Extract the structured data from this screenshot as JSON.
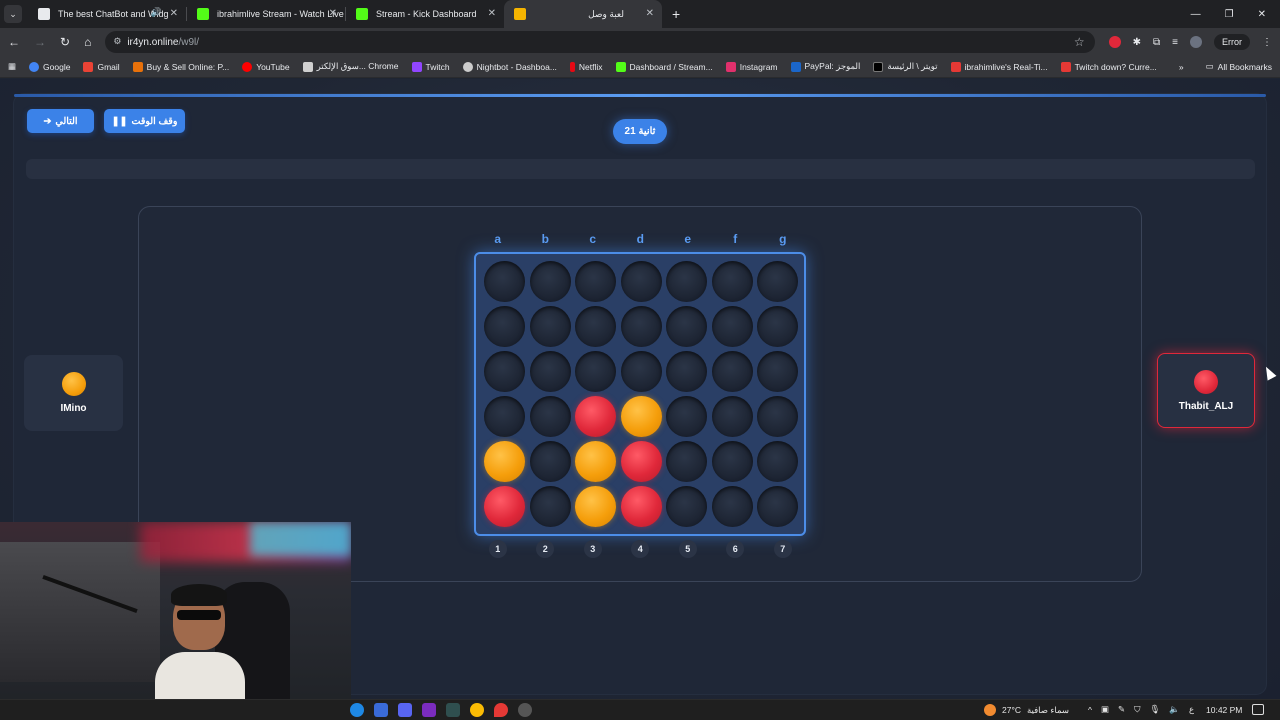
{
  "browser": {
    "tabs": [
      {
        "label": "The best ChatBot and Widg",
        "favicon_color": "#e8eaed"
      },
      {
        "label": "ibrahimlive Stream - Watch Live",
        "favicon_color": "#53fc18"
      },
      {
        "label": "Stream - Kick Dashboard",
        "favicon_color": "#53fc18"
      },
      {
        "label": "لعبة وصل",
        "favicon_color": "#f5b400"
      }
    ],
    "new_tab": "+",
    "url_domain": "ir4yn.online",
    "url_path": "/w9l/",
    "error_label": "Error",
    "bookmarks": [
      {
        "label": "Google",
        "color": "#4285f4"
      },
      {
        "label": "Gmail",
        "color": "#ea4335"
      },
      {
        "label": "Buy & Sell Online: P...",
        "color": "#e8710a"
      },
      {
        "label": "YouTube",
        "color": "#ff0000"
      },
      {
        "label": "سوق الإلكتر... Chrome",
        "color": "#d0d0d0"
      },
      {
        "label": "Twitch",
        "color": "#9146ff"
      },
      {
        "label": "Nightbot - Dashboa...",
        "color": "#cccccc"
      },
      {
        "label": "Netflix",
        "color": "#e50914"
      },
      {
        "label": "Dashboard / Stream...",
        "color": "#53fc18"
      },
      {
        "label": "Instagram",
        "color": "#e1306c"
      },
      {
        "label": "PayPal: الموجز",
        "color": "#1b66c9"
      },
      {
        "label": "تويتر \\ الرئيسة",
        "color": "#000000"
      },
      {
        "label": "ibrahimlive's Real-Ti...",
        "color": "#e53935"
      },
      {
        "label": "Twitch down? Curre...",
        "color": "#e53935"
      }
    ],
    "all_bookmarks": "All Bookmarks"
  },
  "game": {
    "next_button": "التالي",
    "pause_button": "وقف الوقت",
    "timer": "21 ثانية",
    "column_letters": [
      "a",
      "b",
      "c",
      "d",
      "e",
      "f",
      "g"
    ],
    "column_numbers": [
      "1",
      "2",
      "3",
      "4",
      "5",
      "6",
      "7"
    ],
    "board": [
      [
        "",
        "",
        "",
        "",
        "",
        "",
        ""
      ],
      [
        "",
        "",
        "",
        "",
        "",
        "",
        ""
      ],
      [
        "",
        "",
        "",
        "",
        "",
        "",
        ""
      ],
      [
        "",
        "",
        "red",
        "orange",
        "",
        "",
        ""
      ],
      [
        "orange",
        "",
        "orange",
        "red",
        "",
        "",
        ""
      ],
      [
        "red",
        "",
        "orange",
        "red",
        "",
        "",
        ""
      ]
    ],
    "player_left": {
      "name": "IMino",
      "disc_color": "orange"
    },
    "player_right": {
      "name": "Thabit_ALJ",
      "disc_color": "red",
      "active": true
    }
  },
  "taskbar": {
    "temperature": "27°C",
    "weather": "سماء صافية",
    "lang": "ع",
    "time": "10:42 PM"
  }
}
